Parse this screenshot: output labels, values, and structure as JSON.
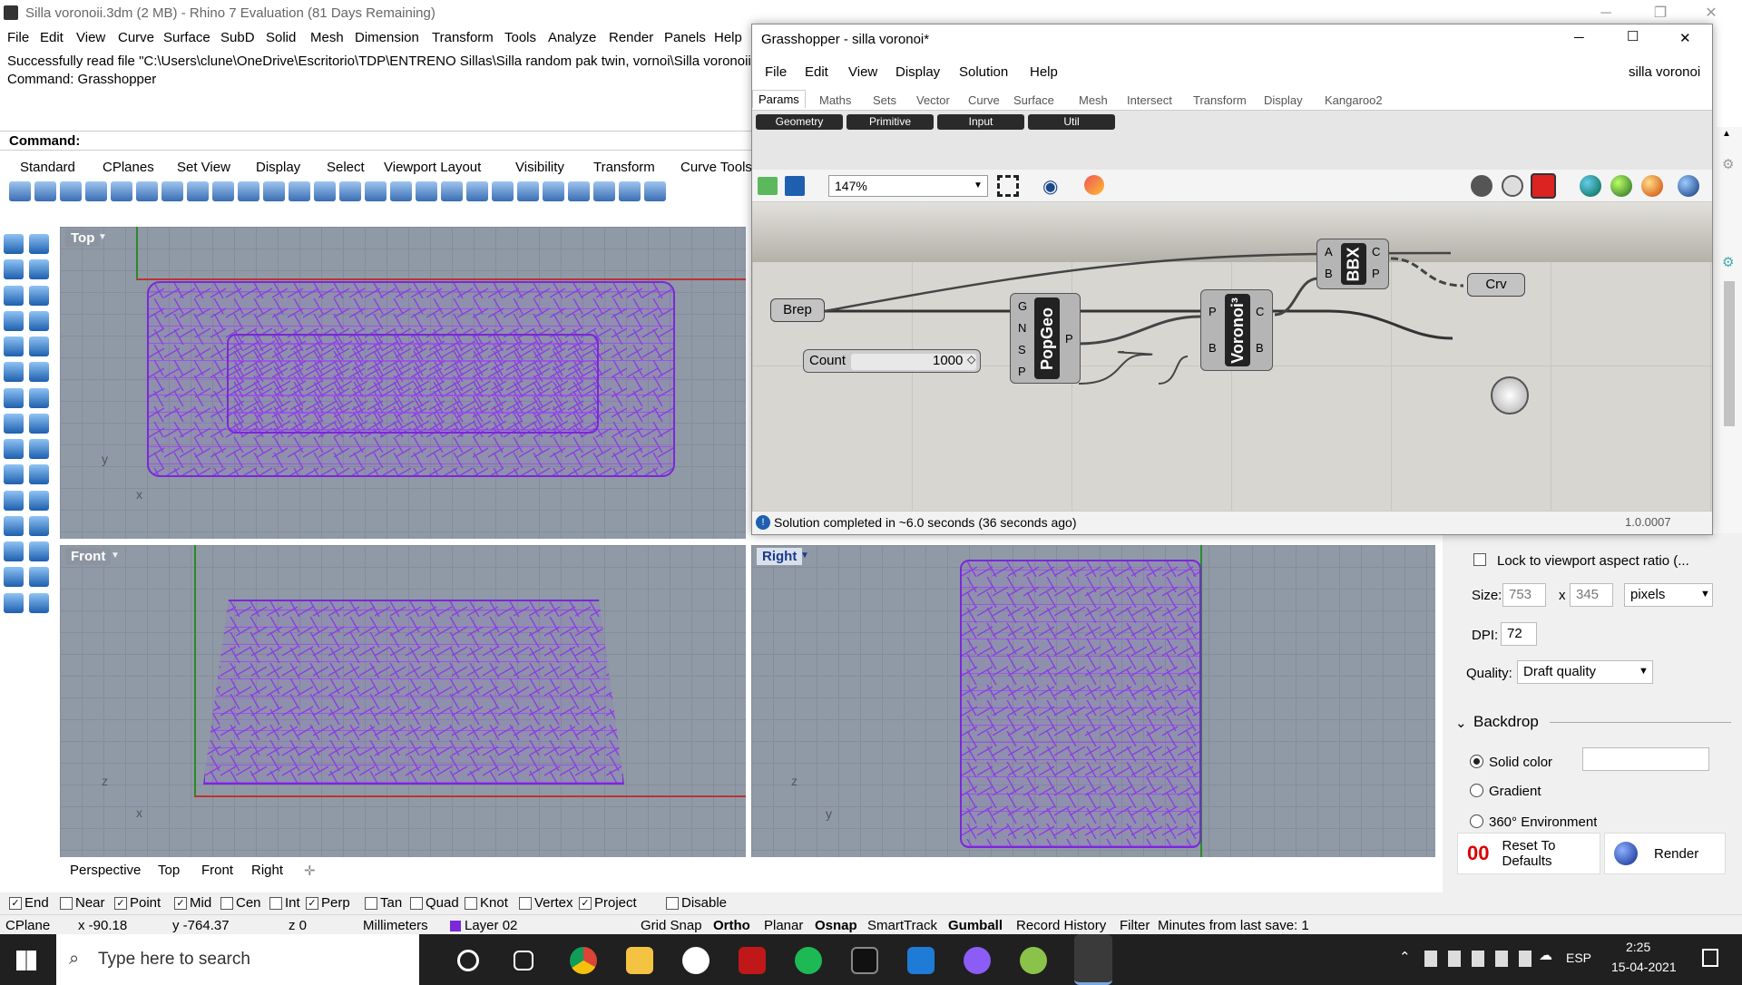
{
  "rhino": {
    "title": "Silla voronoii.3dm (2 MB) - Rhino 7 Evaluation (81 Days Remaining)",
    "menu": [
      "File",
      "Edit",
      "View",
      "Curve",
      "Surface",
      "SubD",
      "Solid",
      "Mesh",
      "Dimension",
      "Transform",
      "Tools",
      "Analyze",
      "Render",
      "Panels",
      "Help"
    ],
    "history": [
      "Successfully read file \"C:\\Users\\clune\\OneDrive\\Escritorio\\TDP\\ENTRENO Sillas\\Silla random pak twin, vornoi\\Silla voronoii.3",
      "Command: Grasshopper"
    ],
    "command_label": "Command:",
    "toolbar_tabs": [
      "Standard",
      "CPlanes",
      "Set View",
      "Display",
      "Select",
      "Viewport Layout",
      "Visibility",
      "Transform",
      "Curve Tools"
    ],
    "viewports": {
      "top": "Top",
      "front": "Front",
      "right": "Right"
    },
    "viewport_tabs": [
      "Perspective",
      "Top",
      "Front",
      "Right"
    ],
    "axes": {
      "x": "x",
      "y": "y",
      "z": "z"
    },
    "osnap": [
      {
        "label": "End",
        "checked": true
      },
      {
        "label": "Near",
        "checked": false
      },
      {
        "label": "Point",
        "checked": true
      },
      {
        "label": "Mid",
        "checked": true
      },
      {
        "label": "Cen",
        "checked": false
      },
      {
        "label": "Int",
        "checked": false
      },
      {
        "label": "Perp",
        "checked": true
      },
      {
        "label": "Tan",
        "checked": false
      },
      {
        "label": "Quad",
        "checked": false
      },
      {
        "label": "Knot",
        "checked": false
      },
      {
        "label": "Vertex",
        "checked": false
      },
      {
        "label": "Project",
        "checked": true
      },
      {
        "label": "Disable",
        "checked": false
      }
    ],
    "status": {
      "cplane": "CPlane",
      "x": "x -90.18",
      "y": "y -764.37",
      "z": "z 0",
      "units": "Millimeters",
      "layer": "Layer 02",
      "grid_snap": "Grid Snap",
      "ortho": "Ortho",
      "planar": "Planar",
      "osnap": "Osnap",
      "smarttrack": "SmartTrack",
      "gumball": "Gumball",
      "record": "Record History",
      "filter": "Filter",
      "minutes": "Minutes from last save: 1"
    }
  },
  "panel": {
    "lock_label": "Lock to viewport aspect ratio (...",
    "size_label": "Size:",
    "width": "753",
    "x": "x",
    "height": "345",
    "units": "pixels",
    "dpi_label": "DPI:",
    "dpi": "72",
    "quality_label": "Quality:",
    "quality": "Draft quality",
    "backdrop": "Backdrop",
    "solid": "Solid color",
    "gradient": "Gradient",
    "env": "360° Environment",
    "reset": "Reset To Defaults",
    "render": "Render"
  },
  "gh": {
    "title": "Grasshopper - silla voronoi*",
    "menu": [
      "File",
      "Edit",
      "View",
      "Display",
      "Solution",
      "Help"
    ],
    "doc": "silla voronoi",
    "tabs": [
      "Params",
      "Maths",
      "Sets",
      "Vector",
      "Curve",
      "Surface",
      "Mesh",
      "Intersect",
      "Transform",
      "Display",
      "Kangaroo2"
    ],
    "groups": [
      "Geometry",
      "Primitive",
      "Input",
      "Util"
    ],
    "zoom": "147%",
    "nodes": {
      "brep": "Brep",
      "count": "Count",
      "count_val": "1000",
      "popgeo": "PopGeo",
      "voronoi": "Voronoi³",
      "bbx": "BBX",
      "crv": "Crv"
    },
    "ports": {
      "pop_in": [
        "G",
        "N",
        "S",
        "P"
      ],
      "pop_out": "P",
      "vor_in": [
        "P",
        "B"
      ],
      "vor_out": [
        "C",
        "B"
      ],
      "bbx_in": [
        "A",
        "B"
      ],
      "bbx_out": [
        "C",
        "P"
      ]
    },
    "status": "Solution completed in ~6.0 seconds (36 seconds ago)",
    "version": "1.0.0007"
  },
  "taskbar": {
    "search": "Type here to search",
    "lang": "ESP",
    "time": "2:25",
    "date": "15-04-2021"
  }
}
